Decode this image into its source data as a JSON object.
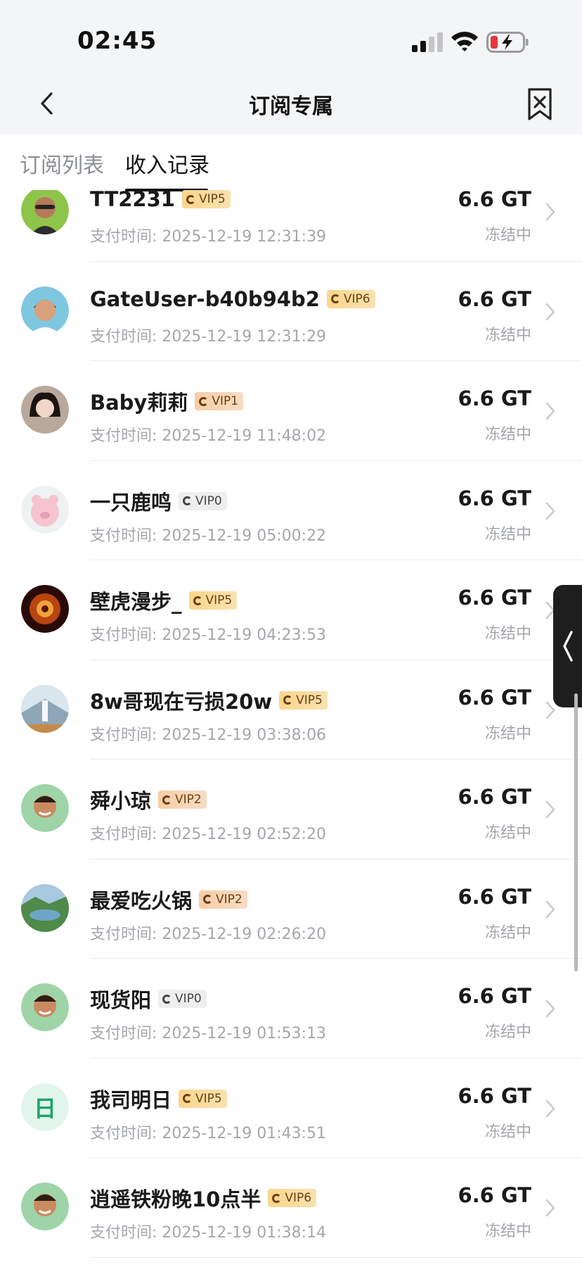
{
  "status_bar": {
    "time": "02:45"
  },
  "nav": {
    "title": "订阅专属"
  },
  "tabs": [
    {
      "label": "订阅列表",
      "active": false
    },
    {
      "label": "收入记录",
      "active": true
    }
  ],
  "colors": {
    "vip_gold": "#fbd58c",
    "vip_peach": "#f8cda6",
    "vip_grey": "#eeeeef",
    "battery_low": "#e5383b"
  },
  "records": [
    {
      "name": "TT2231",
      "vip": "VIP5",
      "time": "支付时间: 2025-12-19 12:31:39",
      "amount": "6.6 GT",
      "status": "冻结中"
    },
    {
      "name": "GateUser-b40b94b2",
      "vip": "VIP6",
      "time": "支付时间: 2025-12-19 12:31:29",
      "amount": "6.6 GT",
      "status": "冻结中"
    },
    {
      "name": "Baby莉莉",
      "vip": "VIP1",
      "time": "支付时间: 2025-12-19 11:48:02",
      "amount": "6.6 GT",
      "status": "冻结中"
    },
    {
      "name": "一只鹿鸣",
      "vip": "VIP0",
      "time": "支付时间: 2025-12-19 05:00:22",
      "amount": "6.6 GT",
      "status": "冻结中"
    },
    {
      "name": "壁虎漫步_",
      "vip": "VIP5",
      "time": "支付时间: 2025-12-19 04:23:53",
      "amount": "6.6 GT",
      "status": "冻结中"
    },
    {
      "name": "8w哥现在亏损20w",
      "vip": "VIP5",
      "time": "支付时间: 2025-12-19 03:38:06",
      "amount": "6.6 GT",
      "status": "冻结中"
    },
    {
      "name": "舜小琼",
      "vip": "VIP2",
      "time": "支付时间: 2025-12-19 02:52:20",
      "amount": "6.6 GT",
      "status": "冻结中"
    },
    {
      "name": "最爱吃火锅",
      "vip": "VIP2",
      "time": "支付时间: 2025-12-19 02:26:20",
      "amount": "6.6 GT",
      "status": "冻结中"
    },
    {
      "name": "现货阳",
      "vip": "VIP0",
      "time": "支付时间: 2025-12-19 01:53:13",
      "amount": "6.6 GT",
      "status": "冻结中"
    },
    {
      "name": "我司明日",
      "vip": "VIP5",
      "time": "支付时间: 2025-12-19 01:43:51",
      "amount": "6.6 GT",
      "status": "冻结中",
      "avatar_text": "日"
    },
    {
      "name": "逍遥铁粉晚10点半",
      "vip": "VIP6",
      "time": "支付时间: 2025-12-19 01:38:14",
      "amount": "6.6 GT",
      "status": "冻结中"
    }
  ]
}
